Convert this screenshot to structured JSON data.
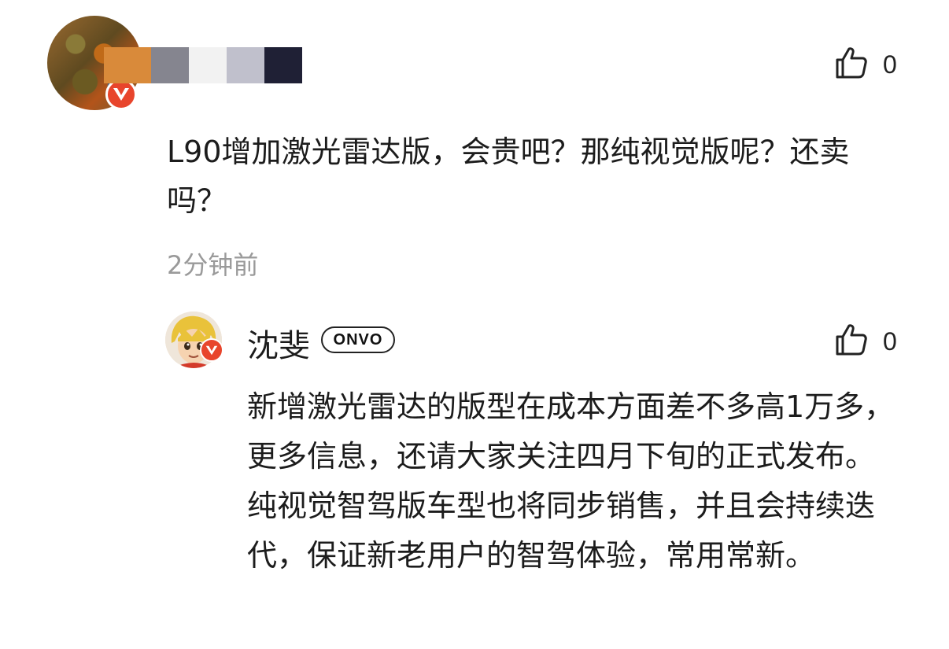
{
  "comment": {
    "text": "L90增加激光雷达版，会贵吧？那纯视觉版呢？还卖吗？",
    "time": "2分钟前",
    "like_count": "0",
    "avatar_icon": "avatar-image",
    "badge_icon": "verified-v-icon"
  },
  "reply": {
    "author": "沈斐",
    "tag": "ONVO",
    "text": "新增激光雷达的版型在成本方面差不多高1万多，更多信息，还请大家关注四月下旬的正式发布。 纯视觉智驾版车型也将同步销售，并且会持续迭代，保证新老用户的智驾体验，常用常新。",
    "like_count": "0",
    "avatar_icon": "avatar-image",
    "badge_icon": "verified-v-icon"
  },
  "colors": {
    "badge": "#e8452c",
    "time_text": "#9a9a9a",
    "body_text": "#1c1c1c"
  }
}
